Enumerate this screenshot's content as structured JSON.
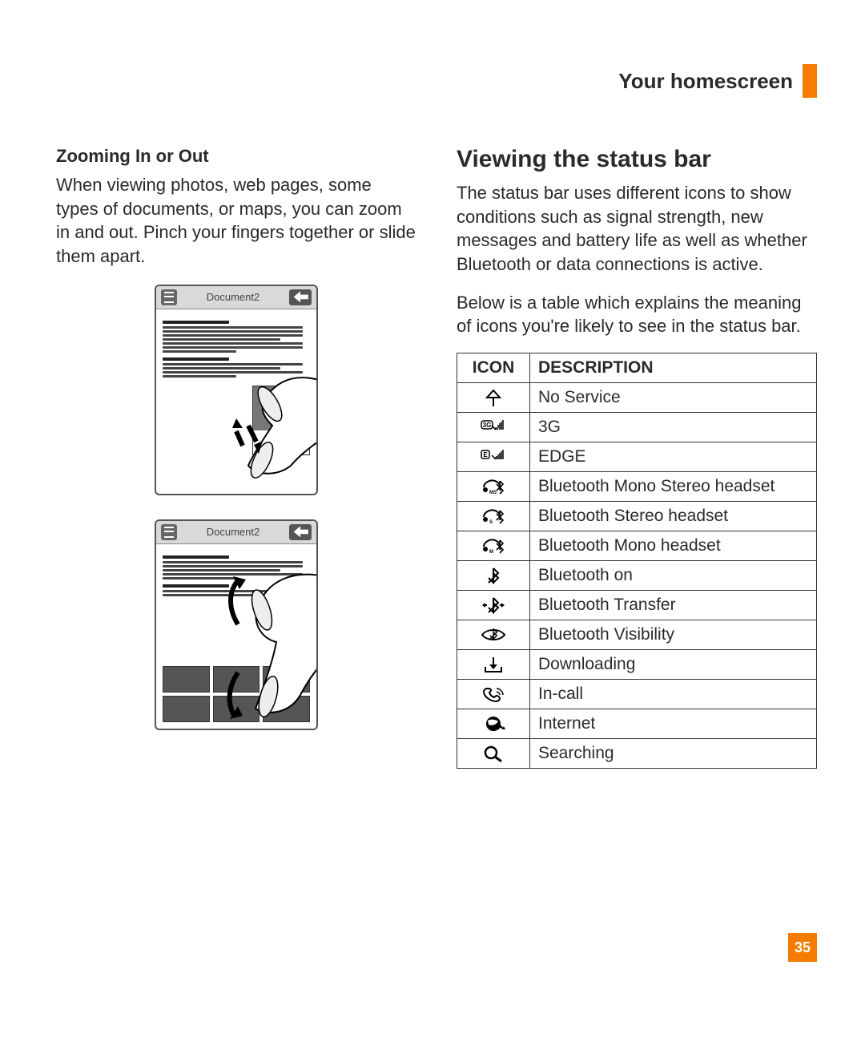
{
  "header": {
    "section": "Your homescreen"
  },
  "left": {
    "zoom_heading": "Zooming In or Out",
    "zoom_body": "When viewing photos, web pages, some types of documents, or maps, you can zoom in and out. Pinch your fingers together or slide them apart.",
    "mock_title": "Document2"
  },
  "right": {
    "heading": "Viewing the status bar",
    "para1": "The status bar uses different icons to show conditions such as signal strength, new messages and battery life as well as whether Bluetooth or data connections is active.",
    "para2": "Below is a table which explains the meaning of icons you're likely to see in the status bar.",
    "table": {
      "head_icon": "ICON",
      "head_desc": "DESCRIPTION",
      "rows": [
        {
          "id": "no-service",
          "desc": "No Service"
        },
        {
          "id": "3g",
          "desc": "3G"
        },
        {
          "id": "edge",
          "desc": "EDGE"
        },
        {
          "id": "bt-ms",
          "desc": "Bluetooth Mono Stereo headset"
        },
        {
          "id": "bt-s",
          "desc": "Bluetooth Stereo headset"
        },
        {
          "id": "bt-m",
          "desc": "Bluetooth Mono headset"
        },
        {
          "id": "bt-on",
          "desc": "Bluetooth on"
        },
        {
          "id": "bt-transfer",
          "desc": "Bluetooth Transfer"
        },
        {
          "id": "bt-vis",
          "desc": "Bluetooth Visibility"
        },
        {
          "id": "download",
          "desc": "Downloading"
        },
        {
          "id": "in-call",
          "desc": "In-call"
        },
        {
          "id": "internet",
          "desc": "Internet"
        },
        {
          "id": "search",
          "desc": "Searching"
        }
      ]
    }
  },
  "page_number": "35"
}
